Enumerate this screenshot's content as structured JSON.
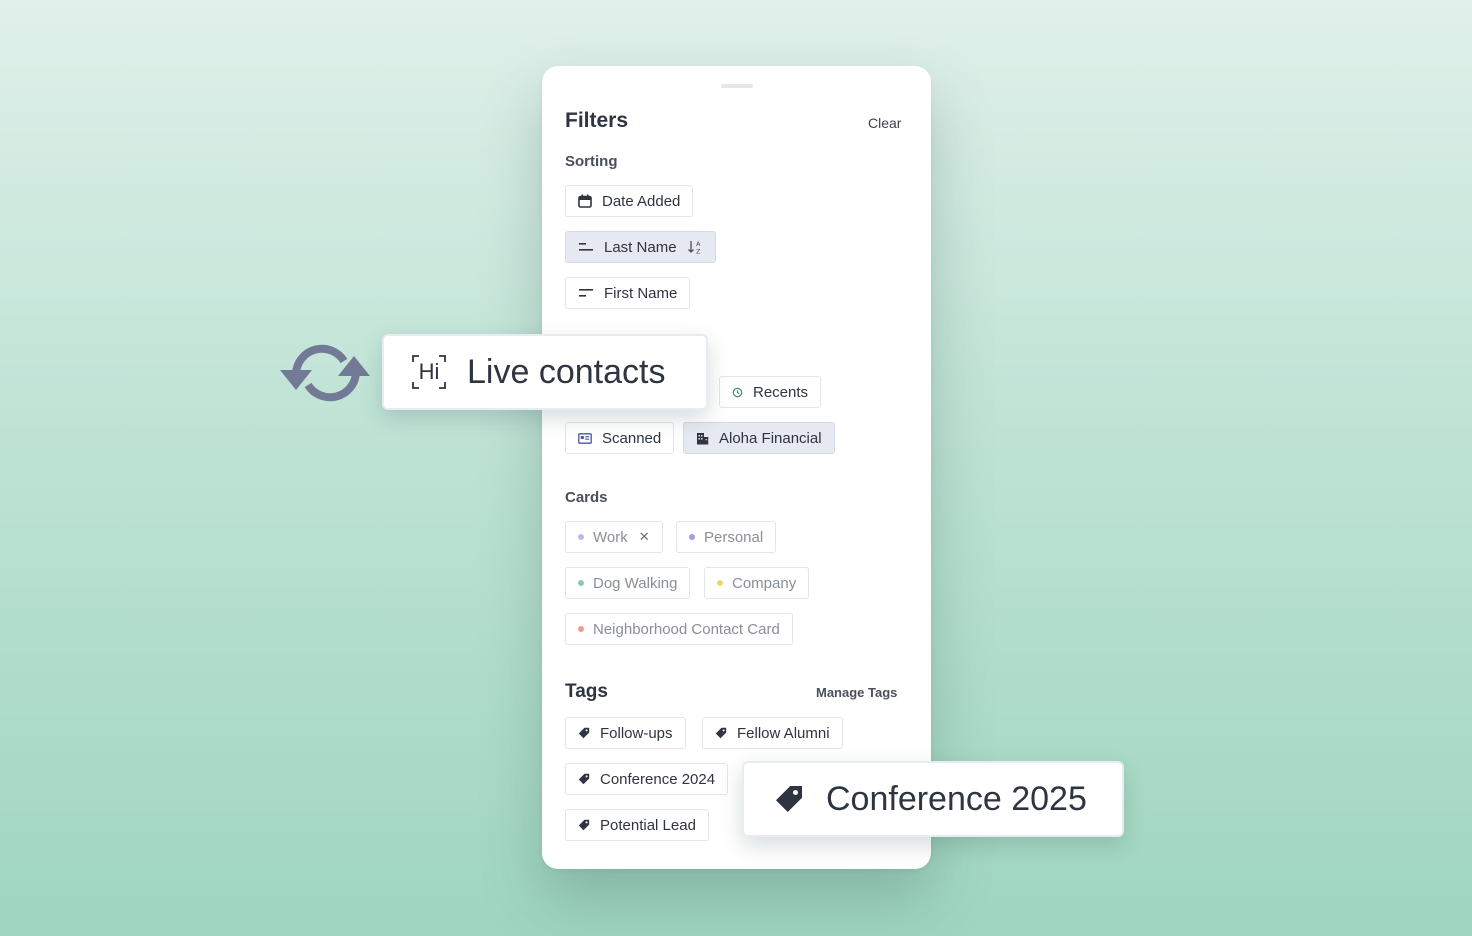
{
  "filters": {
    "title": "Filters",
    "clear_label": "Clear",
    "sorting": {
      "title": "Sorting",
      "options": [
        {
          "label": "Date Added",
          "icon": "calendar-icon"
        },
        {
          "label": "Last Name",
          "icon": "align-lines-icon",
          "selected": true,
          "direction_icon": "sort-ascending-icon"
        },
        {
          "label": "First Name",
          "icon": "align-lines-icon"
        }
      ]
    },
    "sources": {
      "options": [
        {
          "label": "Recents",
          "icon": "history-icon"
        },
        {
          "label": "Scanned",
          "icon": "id-card-icon"
        },
        {
          "label": "Aloha Financial",
          "icon": "building-icon",
          "selected": true
        }
      ]
    },
    "cards": {
      "title": "Cards",
      "items": [
        {
          "label": "Work",
          "dot_color": "#c9b4ec",
          "removable": true
        },
        {
          "label": "Personal",
          "dot_color": "#9aa3e0"
        },
        {
          "label": "Dog Walking",
          "dot_color": "#8cc9b0"
        },
        {
          "label": "Company",
          "dot_color": "#f2d26a"
        },
        {
          "label": "Neighborhood Contact Card",
          "dot_color": "#f2998d"
        }
      ]
    },
    "tags": {
      "title": "Tags",
      "manage_label": "Manage Tags",
      "items": [
        {
          "label": "Follow-ups"
        },
        {
          "label": "Fellow Alumni"
        },
        {
          "label": "Conference 2024"
        },
        {
          "label": "Potential Lead"
        }
      ]
    }
  },
  "overlays": {
    "live_contacts": {
      "label": "Live contacts",
      "badge_text": "Hi",
      "icon": "sync-icon"
    },
    "new_tag": {
      "label": "Conference 2025",
      "icon": "tag-icon"
    }
  },
  "colors": {
    "selected_chip": "#e6e9f2",
    "sync_icon": "#737a96"
  }
}
